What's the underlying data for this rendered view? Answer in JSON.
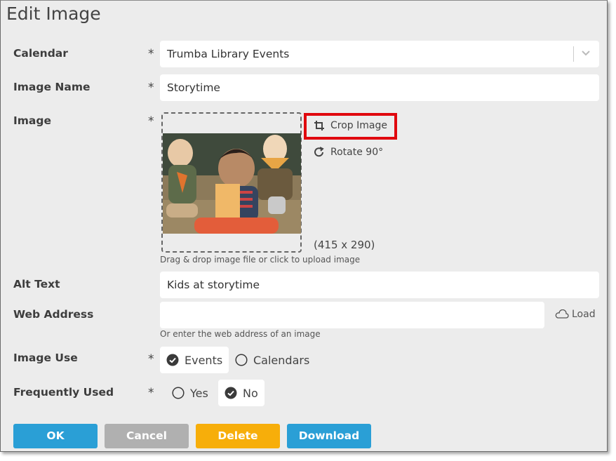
{
  "dialog": {
    "title": "Edit Image"
  },
  "form": {
    "calendar": {
      "label": "Calendar",
      "required_mark": "*",
      "value": "Trumba Library Events"
    },
    "image_name": {
      "label": "Image Name",
      "required_mark": "*",
      "value": "Storytime"
    },
    "image": {
      "label": "Image",
      "required_mark": "*",
      "photo_alt": "Kids at storytime",
      "crop_label": "Crop Image",
      "rotate_label": "Rotate 90°",
      "dimensions": "(415 x 290)",
      "dropzone_hint": "Drag & drop image file or click to upload image"
    },
    "alt_text": {
      "label": "Alt Text",
      "value": "Kids at storytime"
    },
    "web_address": {
      "label": "Web Address",
      "value": "",
      "load_label": "Load",
      "hint": "Or enter the web address of an image"
    },
    "image_use": {
      "label": "Image Use",
      "required_mark": "*",
      "options": [
        {
          "label": "Events",
          "selected": true
        },
        {
          "label": "Calendars",
          "selected": false
        }
      ]
    },
    "frequently_used": {
      "label": "Frequently Used",
      "required_mark": "*",
      "options": [
        {
          "label": "Yes",
          "selected": false
        },
        {
          "label": "No",
          "selected": true
        }
      ]
    }
  },
  "buttons": {
    "ok": "OK",
    "cancel": "Cancel",
    "delete": "Delete",
    "download": "Download"
  },
  "colors": {
    "primary": "#2a9fd6",
    "neutral": "#b0b0b0",
    "warning": "#f7ae0a",
    "highlight": "#e0070e"
  }
}
